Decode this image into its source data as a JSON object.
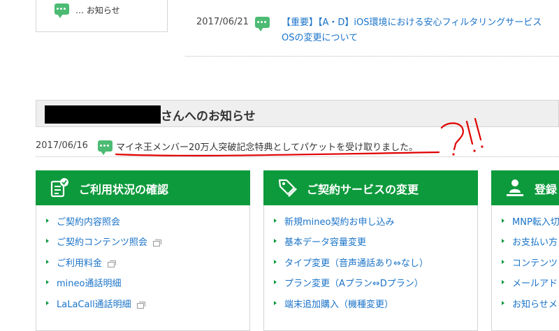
{
  "legend": {
    "label": "… お知らせ"
  },
  "news": {
    "date": "2017/06/21",
    "tag": "【重要】",
    "title_line1": "【A・D】iOS環境における安心フィルタリングサービス",
    "title_line2": "OSの変更について"
  },
  "notice": {
    "title": "さんへのお知らせ",
    "date": "2017/06/16",
    "text": "マイネ王メンバー20万人突破記念特典としてパケットを受け取りました。",
    "annotation": "?!"
  },
  "panels": [
    {
      "title": "ご利用状況の確認",
      "icon": "clipboard-check-icon",
      "items": [
        {
          "label": "ご契約内容照会",
          "external": false
        },
        {
          "label": "ご契約コンテンツ照会",
          "external": true
        },
        {
          "label": "ご利用料金",
          "external": true
        },
        {
          "label": "mineo通話明細",
          "external": false
        },
        {
          "label": "LaLaCall通話明細",
          "external": true
        }
      ]
    },
    {
      "title": "ご契約サービスの変更",
      "icon": "tag-pen-icon",
      "items": [
        {
          "label": "新規mineo契約お申し込み",
          "external": false
        },
        {
          "label": "基本データ容量変更",
          "external": false
        },
        {
          "label": "タイプ変更（音声通話あり⇔なし）",
          "external": false
        },
        {
          "label": "プラン変更（Aプラン⇔Dプラン）",
          "external": false
        },
        {
          "label": "端末追加購入（機種変更）",
          "external": false
        }
      ]
    },
    {
      "title": "登録",
      "icon": "user-register-icon",
      "items": [
        {
          "label": "MNP転入切",
          "external": false
        },
        {
          "label": "お支払い方",
          "external": false
        },
        {
          "label": "コンテンツ",
          "external": false
        },
        {
          "label": "メールアド",
          "external": false
        },
        {
          "label": "お知らせメ",
          "external": false
        }
      ]
    }
  ],
  "colors": {
    "brand_green": "#0d9a3c",
    "link_blue": "#1a73c8",
    "annotation_red": "#e00000"
  }
}
